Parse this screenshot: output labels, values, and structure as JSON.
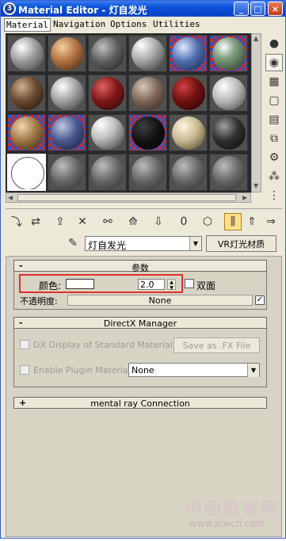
{
  "window": {
    "title": "Material Editor - 灯自发光"
  },
  "menu": {
    "items": [
      "Material",
      "Navigation",
      "Options",
      "Utilities"
    ]
  },
  "material": {
    "name": "灯自发光",
    "type_button": "VR灯光材质"
  },
  "params": {
    "rollout_title": "参数",
    "color_label": "颜色:",
    "color_value": "#ffffff",
    "multiplier_value": "2.0",
    "two_sided_label": "双面",
    "opacity_label": "不透明度:",
    "opacity_map": "None"
  },
  "directx": {
    "rollout_title": "DirectX Manager",
    "dx_display_label": "DX Display of Standard Material",
    "save_fx_label": "Save as .FX File",
    "enable_plugin_label": "Enable Plugin Material",
    "plugin_value": "None"
  },
  "mental_ray": {
    "rollout_title": "mental ray Connection"
  },
  "watermark": {
    "site_name": "中国教程网",
    "url": "www.jcwcn.com"
  }
}
